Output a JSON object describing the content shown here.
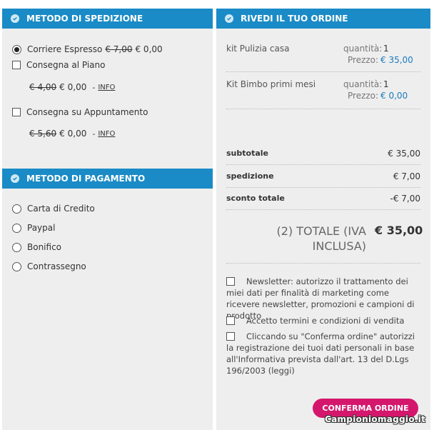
{
  "shipping": {
    "title": "METODO DI SPEDIZIONE",
    "options": [
      {
        "label": "Corriere Espresso",
        "old_price": "€ 7,00",
        "price": "€ 0,00",
        "selected": true
      },
      {
        "label": "Consegna al Piano",
        "old_price": "€ 4,00",
        "price": "€ 0,00",
        "info": "INFO"
      },
      {
        "label": "Consegna su Appuntamento",
        "old_price": "€ 5,60",
        "price": "€ 0,00",
        "info": "INFO"
      }
    ],
    "dash": "-"
  },
  "payment": {
    "title": "METODO DI PAGAMENTO",
    "options": [
      "Carta di Credito",
      "Paypal",
      "Bonifico",
      "Contrassegno"
    ]
  },
  "order": {
    "title": "RIVEDI IL TUO ORDINE",
    "qty_label": "quantità:",
    "price_label": "Prezzo:",
    "items": [
      {
        "name": "kit Pulizia casa",
        "qty": "1",
        "price": "€ 35,00"
      },
      {
        "name": "Kit Bimbo primi mesi",
        "qty": "1",
        "price": "€ 0,00"
      }
    ],
    "summary": [
      {
        "label": "subtotale",
        "value": "€ 35,00"
      },
      {
        "label": "spedizione",
        "value": "€ 7,00"
      },
      {
        "label": "sconto totale",
        "value": "-€ 7,00"
      }
    ],
    "total_label": "(2) TOTALE (IVA INCLUSA)",
    "total_value": "€ 35,00",
    "consents": [
      "Newsletter: autorizzo il trattamento dei miei dati per finalità di marketing come ricevere newsletter, promozioni e campioni di prodotto",
      "Accetto termini e condizioni di vendita",
      "Cliccando su \"Conferma ordine\" autorizzi la registrazione dei tuoi dati personali in base all'Informativa prevista dall'art. 13 del D.Lgs 196/2003 (leggi)"
    ],
    "confirm_label": "CONFERMA ORDINE"
  },
  "watermark": "Campioniomaggio.it",
  "colors": {
    "header": "#1a8bc6",
    "accent": "#d4176d",
    "price_blue": "#1a7bbf"
  }
}
